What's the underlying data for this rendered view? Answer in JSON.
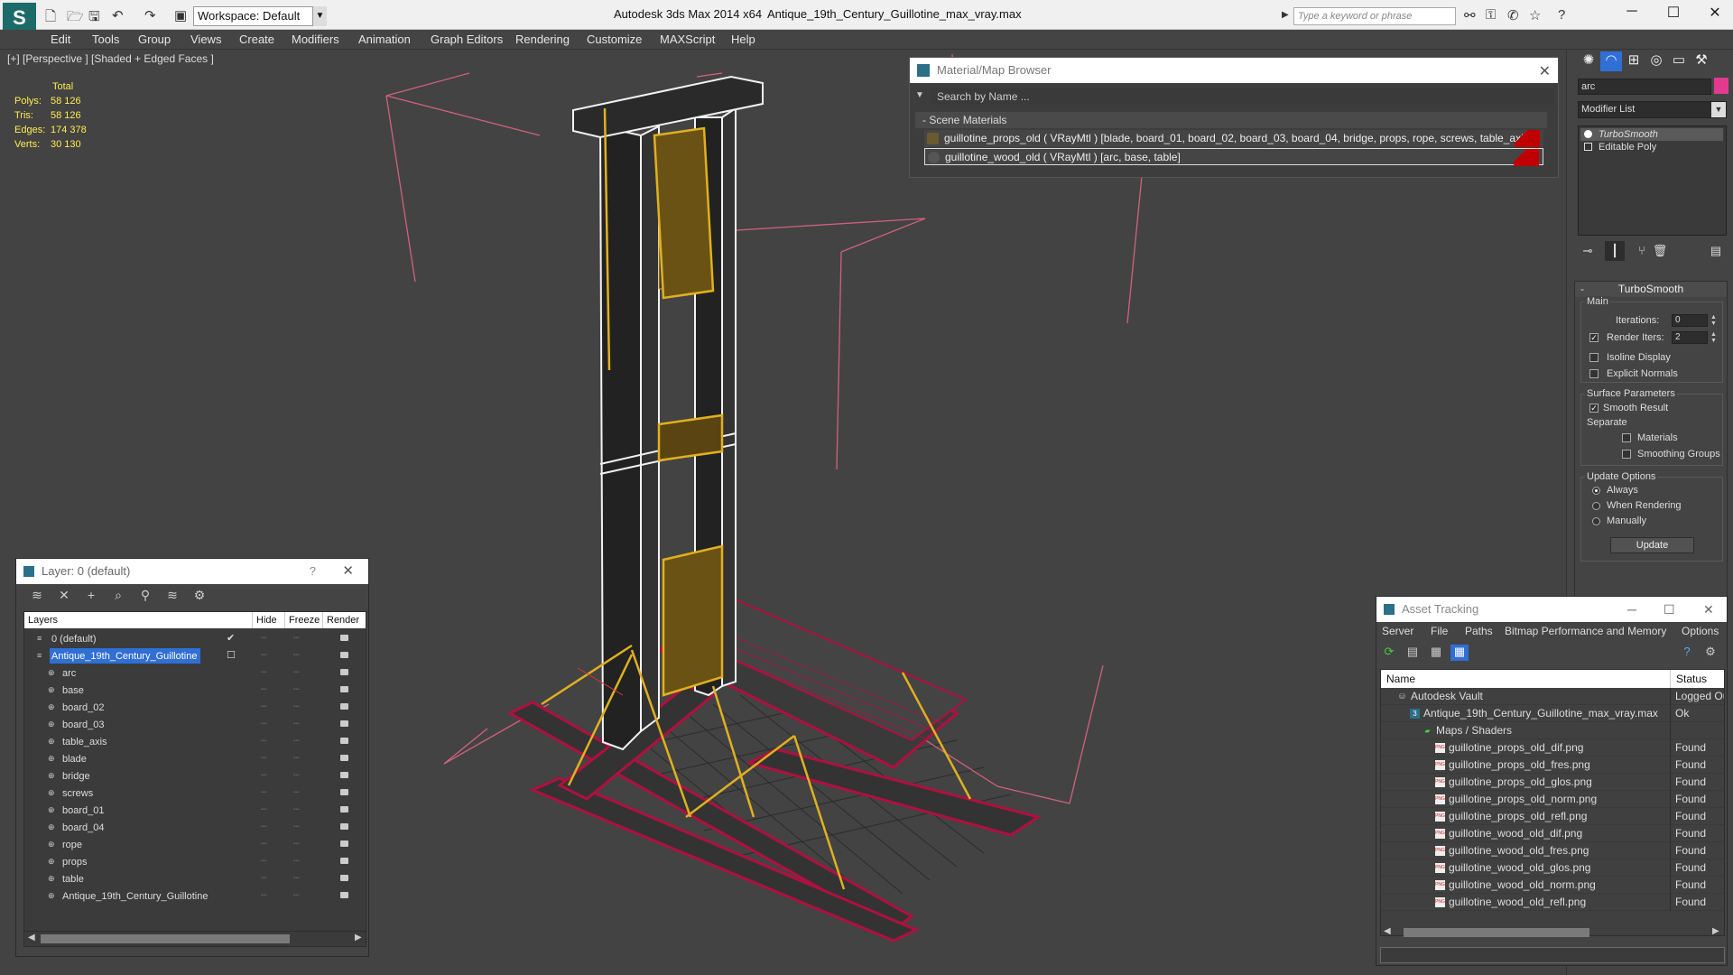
{
  "titlebar": {
    "workspace_label": "Workspace: Default",
    "app_title": "Autodesk 3ds Max  2014 x64",
    "file_title": "Antique_19th_Century_Guillotine_max_vray.max",
    "search_placeholder": "Type a keyword or phrase"
  },
  "menubar": [
    "Edit",
    "Tools",
    "Group",
    "Views",
    "Create",
    "Modifiers",
    "Animation",
    "Graph Editors",
    "Rendering",
    "Customize",
    "MAXScript",
    "Help"
  ],
  "viewport": {
    "label": "[+] [Perspective ] [Shaded + Edged Faces ]",
    "stats_header": "Total",
    "stats": [
      {
        "key": "Polys:",
        "value": "58 126"
      },
      {
        "key": "Tris:",
        "value": "58 126"
      },
      {
        "key": "Edges:",
        "value": "174 378"
      },
      {
        "key": "Verts:",
        "value": "30 130"
      }
    ]
  },
  "material_browser": {
    "title": "Material/Map Browser",
    "search_placeholder": "Search by Name ...",
    "group_label": "- Scene Materials",
    "rows": [
      {
        "label": "guillotine_props_old  ( VRayMtl ) [blade, board_01, board_02, board_03, board_04, bridge, props, rope, screws, table_axis]"
      },
      {
        "label": "guillotine_wood_old  ( VRayMtl ) [arc, base, table]"
      }
    ]
  },
  "command_panel": {
    "name_value": "arc",
    "modifier_list_label": "Modifier List",
    "stack": [
      "TurboSmooth",
      "Editable Poly"
    ],
    "rollout_title": "TurboSmooth",
    "main_label": "Main",
    "iterations_label": "Iterations:",
    "iterations_value": "0",
    "render_iters_label": "Render Iters:",
    "render_iters_value": "2",
    "render_iters_checked": true,
    "isoline_label": "Isoline Display",
    "explicit_normals_label": "Explicit Normals",
    "surface_params_label": "Surface Parameters",
    "smooth_result_label": "Smooth Result",
    "separate_label": "Separate",
    "materials_label": "Materials",
    "smoothing_groups_label": "Smoothing Groups",
    "update_options_label": "Update Options",
    "always_label": "Always",
    "when_rendering_label": "When Rendering",
    "manually_label": "Manually",
    "update_button": "Update"
  },
  "layer_explorer": {
    "title": "Layer: 0 (default)",
    "help": "?",
    "columns": {
      "layers": "Layers",
      "hide": "Hide",
      "freeze": "Freeze",
      "render": "Render"
    },
    "rows": [
      {
        "name": "0 (default)",
        "level": 0,
        "selected": false,
        "active": true
      },
      {
        "name": "Antique_19th_Century_Guillotine",
        "level": 0,
        "selected": true,
        "active": false
      },
      {
        "name": "arc",
        "level": 1
      },
      {
        "name": "base",
        "level": 1
      },
      {
        "name": "board_02",
        "level": 1
      },
      {
        "name": "board_03",
        "level": 1
      },
      {
        "name": "table_axis",
        "level": 1
      },
      {
        "name": "blade",
        "level": 1
      },
      {
        "name": "bridge",
        "level": 1
      },
      {
        "name": "screws",
        "level": 1
      },
      {
        "name": "board_01",
        "level": 1
      },
      {
        "name": "board_04",
        "level": 1
      },
      {
        "name": "rope",
        "level": 1
      },
      {
        "name": "props",
        "level": 1
      },
      {
        "name": "table",
        "level": 1
      },
      {
        "name": "Antique_19th_Century_Guillotine",
        "level": 1
      }
    ]
  },
  "asset_tracking": {
    "title": "Asset Tracking",
    "menu": [
      "Server",
      "File",
      "Paths",
      "Bitmap Performance and Memory",
      "Options"
    ],
    "columns": {
      "name": "Name",
      "status": "Status"
    },
    "rows": [
      {
        "name": "Autodesk Vault",
        "status": "Logged Ou",
        "indent": 0,
        "icon": "vault"
      },
      {
        "name": "Antique_19th_Century_Guillotine_max_vray.max",
        "status": "Ok",
        "indent": 1,
        "icon": "max"
      },
      {
        "name": "Maps / Shaders",
        "status": "",
        "indent": 2,
        "icon": "folder"
      },
      {
        "name": "guillotine_props_old_dif.png",
        "status": "Found",
        "indent": 3,
        "icon": "png"
      },
      {
        "name": "guillotine_props_old_fres.png",
        "status": "Found",
        "indent": 3,
        "icon": "png"
      },
      {
        "name": "guillotine_props_old_glos.png",
        "status": "Found",
        "indent": 3,
        "icon": "png"
      },
      {
        "name": "guillotine_props_old_norm.png",
        "status": "Found",
        "indent": 3,
        "icon": "png"
      },
      {
        "name": "guillotine_props_old_refl.png",
        "status": "Found",
        "indent": 3,
        "icon": "png"
      },
      {
        "name": "guillotine_wood_old_dif.png",
        "status": "Found",
        "indent": 3,
        "icon": "png"
      },
      {
        "name": "guillotine_wood_old_fres.png",
        "status": "Found",
        "indent": 3,
        "icon": "png"
      },
      {
        "name": "guillotine_wood_old_glos.png",
        "status": "Found",
        "indent": 3,
        "icon": "png"
      },
      {
        "name": "guillotine_wood_old_norm.png",
        "status": "Found",
        "indent": 3,
        "icon": "png"
      },
      {
        "name": "guillotine_wood_old_refl.png",
        "status": "Found",
        "indent": 3,
        "icon": "png"
      }
    ]
  },
  "colors": {
    "accent_blue": "#2f6fd6",
    "stats_yellow": "#ffeb50",
    "object_color": "#e23a8e",
    "material_red": "#c00000"
  }
}
